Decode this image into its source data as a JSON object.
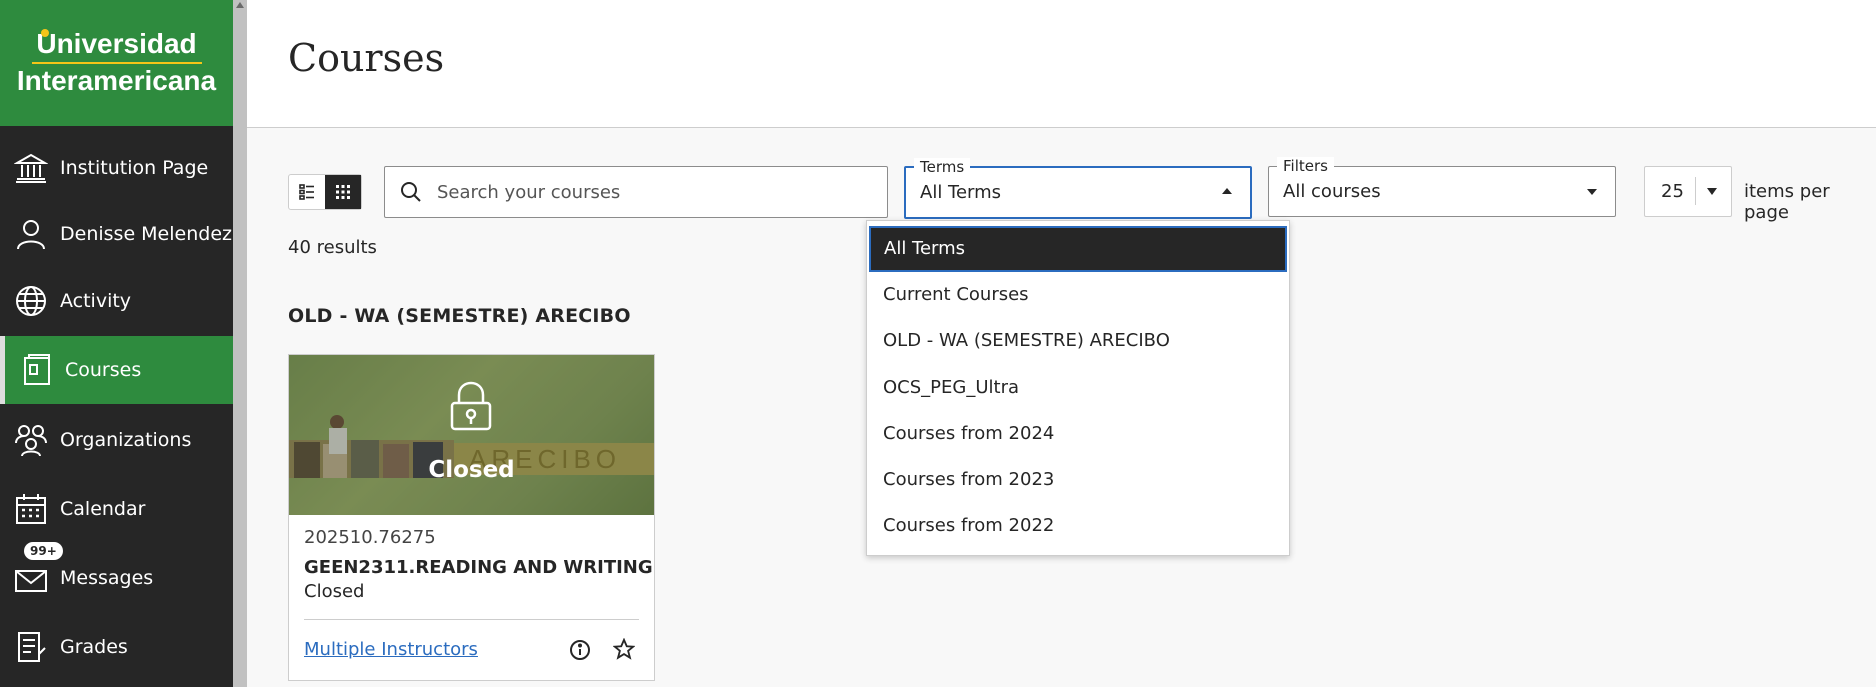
{
  "sidebar": {
    "logo": {
      "line1": "Universidad",
      "line2": "Interamericana"
    },
    "items": [
      {
        "label": "Institution Page",
        "icon": "institution-icon"
      },
      {
        "label": "Denisse Melendez",
        "icon": "user-icon"
      },
      {
        "label": "Activity",
        "icon": "globe-icon"
      },
      {
        "label": "Courses",
        "icon": "courses-icon",
        "active": true
      },
      {
        "label": "Organizations",
        "icon": "organizations-icon"
      },
      {
        "label": "Calendar",
        "icon": "calendar-icon"
      },
      {
        "label": "Messages",
        "icon": "envelope-icon",
        "badge": "99+"
      },
      {
        "label": "Grades",
        "icon": "grades-icon"
      }
    ]
  },
  "page": {
    "title": "Courses"
  },
  "toolbar": {
    "search_placeholder": "Search your courses",
    "terms": {
      "legend": "Terms",
      "value": "All Terms"
    },
    "filters": {
      "legend": "Filters",
      "value": "All courses"
    },
    "per_page": {
      "value": "25",
      "label": "items per page"
    }
  },
  "results": {
    "count": "40 results"
  },
  "term_group": {
    "heading": "OLD - WA (SEMESTRE) ARECIBO"
  },
  "course_card": {
    "banner_text": "ARECIBO",
    "overlay_label": "Closed",
    "code": "202510.76275",
    "name": "GEEN2311.READING AND WRITING",
    "status": "Closed",
    "instructors": "Multiple Instructors"
  },
  "terms_dropdown": {
    "options": [
      "All Terms",
      "Current Courses",
      "OLD - WA (SEMESTRE) ARECIBO",
      "OCS_PEG_Ultra",
      "Courses from 2024",
      "Courses from 2023",
      "Courses from 2022"
    ],
    "selected": "All Terms"
  },
  "colors": {
    "brand_green": "#2e8b3e",
    "sidebar_bg": "#262626",
    "accent_blue": "#2b6cbf",
    "logo_gold": "#f5c518"
  }
}
